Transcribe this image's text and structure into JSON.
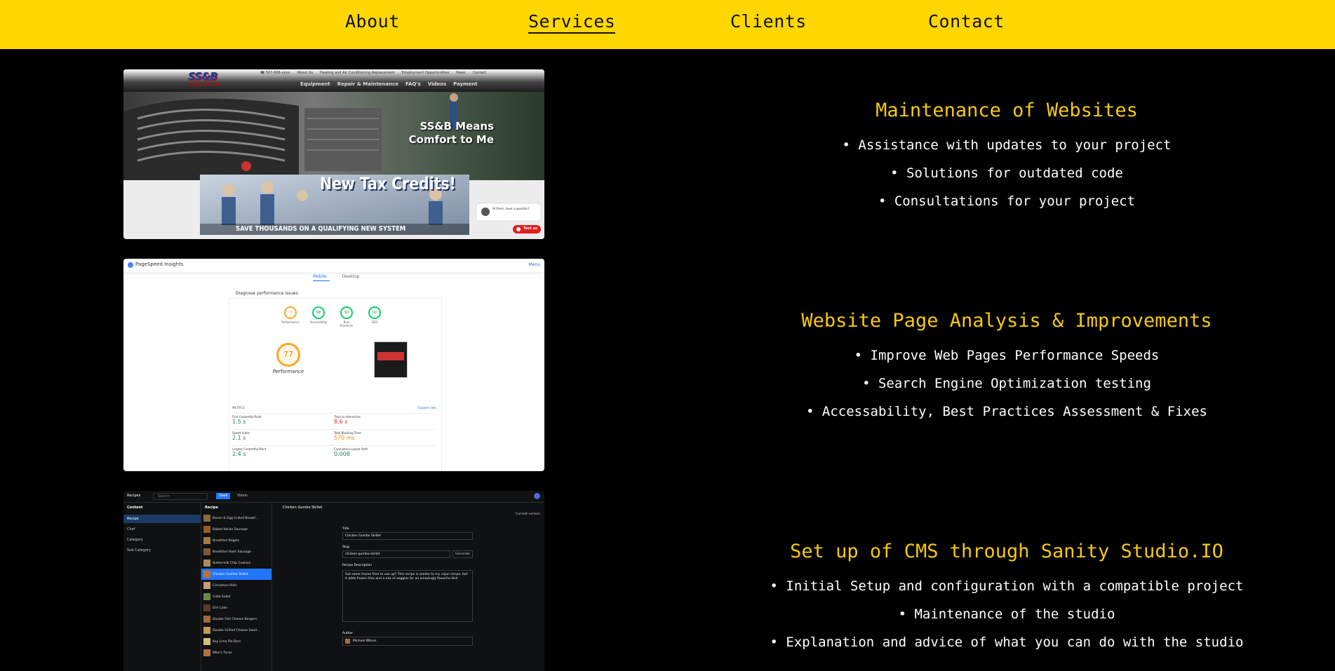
{
  "nav": {
    "items": [
      {
        "label": "About"
      },
      {
        "label": "Services"
      },
      {
        "label": "Clients"
      },
      {
        "label": "Contact"
      }
    ],
    "active": "Services"
  },
  "services": [
    {
      "title": "Maintenance of Websites",
      "items": [
        "Assistance with updates to your project",
        "Solutions for outdated code",
        "Consultations for your project"
      ]
    },
    {
      "title": "Website Page Analysis & Improvements",
      "items": [
        "Improve Web Pages Performance Speeds",
        "Search Engine Optimization testing",
        "Accessability, Best Practices Assessment & Fixes"
      ]
    },
    {
      "title": "Set up of CMS through Sanity Studio.IO",
      "items": [
        "Initial Setup and configuration with a compatible project",
        "Maintenance of the studio",
        "Explanation and advice of what you can do with the studio"
      ]
    }
  ],
  "shots": {
    "ssb": {
      "logo": "SS&B",
      "logo_sub": "HEATING & COOLING",
      "topline": [
        "☎ 507-668-xxxx",
        "About Us",
        "Heating and Air Conditioning Replacement",
        "Employment Opportunities",
        "News",
        "Contact"
      ],
      "menu": [
        "Equipment",
        "Repair & Maintenance",
        "FAQ's",
        "Videos",
        "Payment"
      ],
      "hero_line1": "SS&B Means",
      "hero_line2": "Comfort to Me",
      "promo_title": "New Tax Credits!",
      "promo_sub": "SAVE THOUSANDS ON A QUALIFYING NEW SYSTEM",
      "chat_text": "Hi there, have a question?",
      "chat_button": "Text us"
    },
    "psi": {
      "brand": "PageSpeed Insights",
      "menu": "Menu",
      "tab_mobile": "Mobile",
      "tab_desktop": "Desktop",
      "diagnose": "Diagnose performance issues",
      "scores": [
        {
          "value": "77",
          "label": "Performance",
          "color": "#f9a825"
        },
        {
          "value": "98",
          "label": "Accessibility",
          "color": "#0cce6b"
        },
        {
          "value": "92",
          "label": "Best Practices",
          "color": "#0cce6b"
        },
        {
          "value": "100",
          "label": "SEO",
          "color": "#0cce6b"
        }
      ],
      "big_score": "77",
      "big_label": "Performance",
      "metrics_label": "METRICS",
      "expand": "Expand view",
      "metrics": [
        {
          "name": "First Contentful Paint",
          "value": "1.5 s",
          "color": "#0cce6b"
        },
        {
          "name": "Time to Interactive",
          "value": "8.6 s",
          "color": "#ff4e42"
        },
        {
          "name": "Speed Index",
          "value": "2.1 s",
          "color": "#0cce6b"
        },
        {
          "name": "Total Blocking Time",
          "value": "570 ms",
          "color": "#f9a825"
        },
        {
          "name": "Largest Contentful Paint",
          "value": "2.4 s",
          "color": "#0cce6b"
        },
        {
          "name": "Cumulative Layout Shift",
          "value": "0.008",
          "color": "#0cce6b"
        }
      ]
    },
    "sanity": {
      "app": "Recipes",
      "search": "Search",
      "tab_desk": "Desk",
      "tab_vision": "Vision",
      "content": "Content",
      "content_items": [
        "Recipe",
        "Chef",
        "Category",
        "Sub Category"
      ],
      "list_title": "Recipe",
      "recipes": [
        "Bacon & Egg Grilled Breakf...",
        "Baked Italian Sausage",
        "Breakfast Bagels",
        "Breakfast Hash Sausage",
        "Buttermilk Chip Cookies",
        "Chicken Gumbo Skillet",
        "Cinnamon Rolls",
        "Cobb Salad",
        "Dirt Cake",
        "Double Fish Cheese Burgers",
        "Double Grilled Cheese Sand...",
        "Key Lime Pie Bars",
        "Mike's Tacos"
      ],
      "doc_title": "Chicken Gumbo Skillet",
      "field_title": "Title",
      "field_title_val": "Chicken Gumbo Skillet",
      "field_slug": "Slug",
      "field_slug_val": "chicken-gumbo-skillet",
      "generate": "Generate",
      "field_desc": "Recipe Description",
      "field_desc_val": "Got some frozen fries to use up? This recipe is similar to my cajun recipe, but it adds frozen fries and a mix of veggies for an amazingly flavorful dish.",
      "field_author": "Author",
      "author_val": "Michael Wilson",
      "current_version": "Current version"
    }
  }
}
